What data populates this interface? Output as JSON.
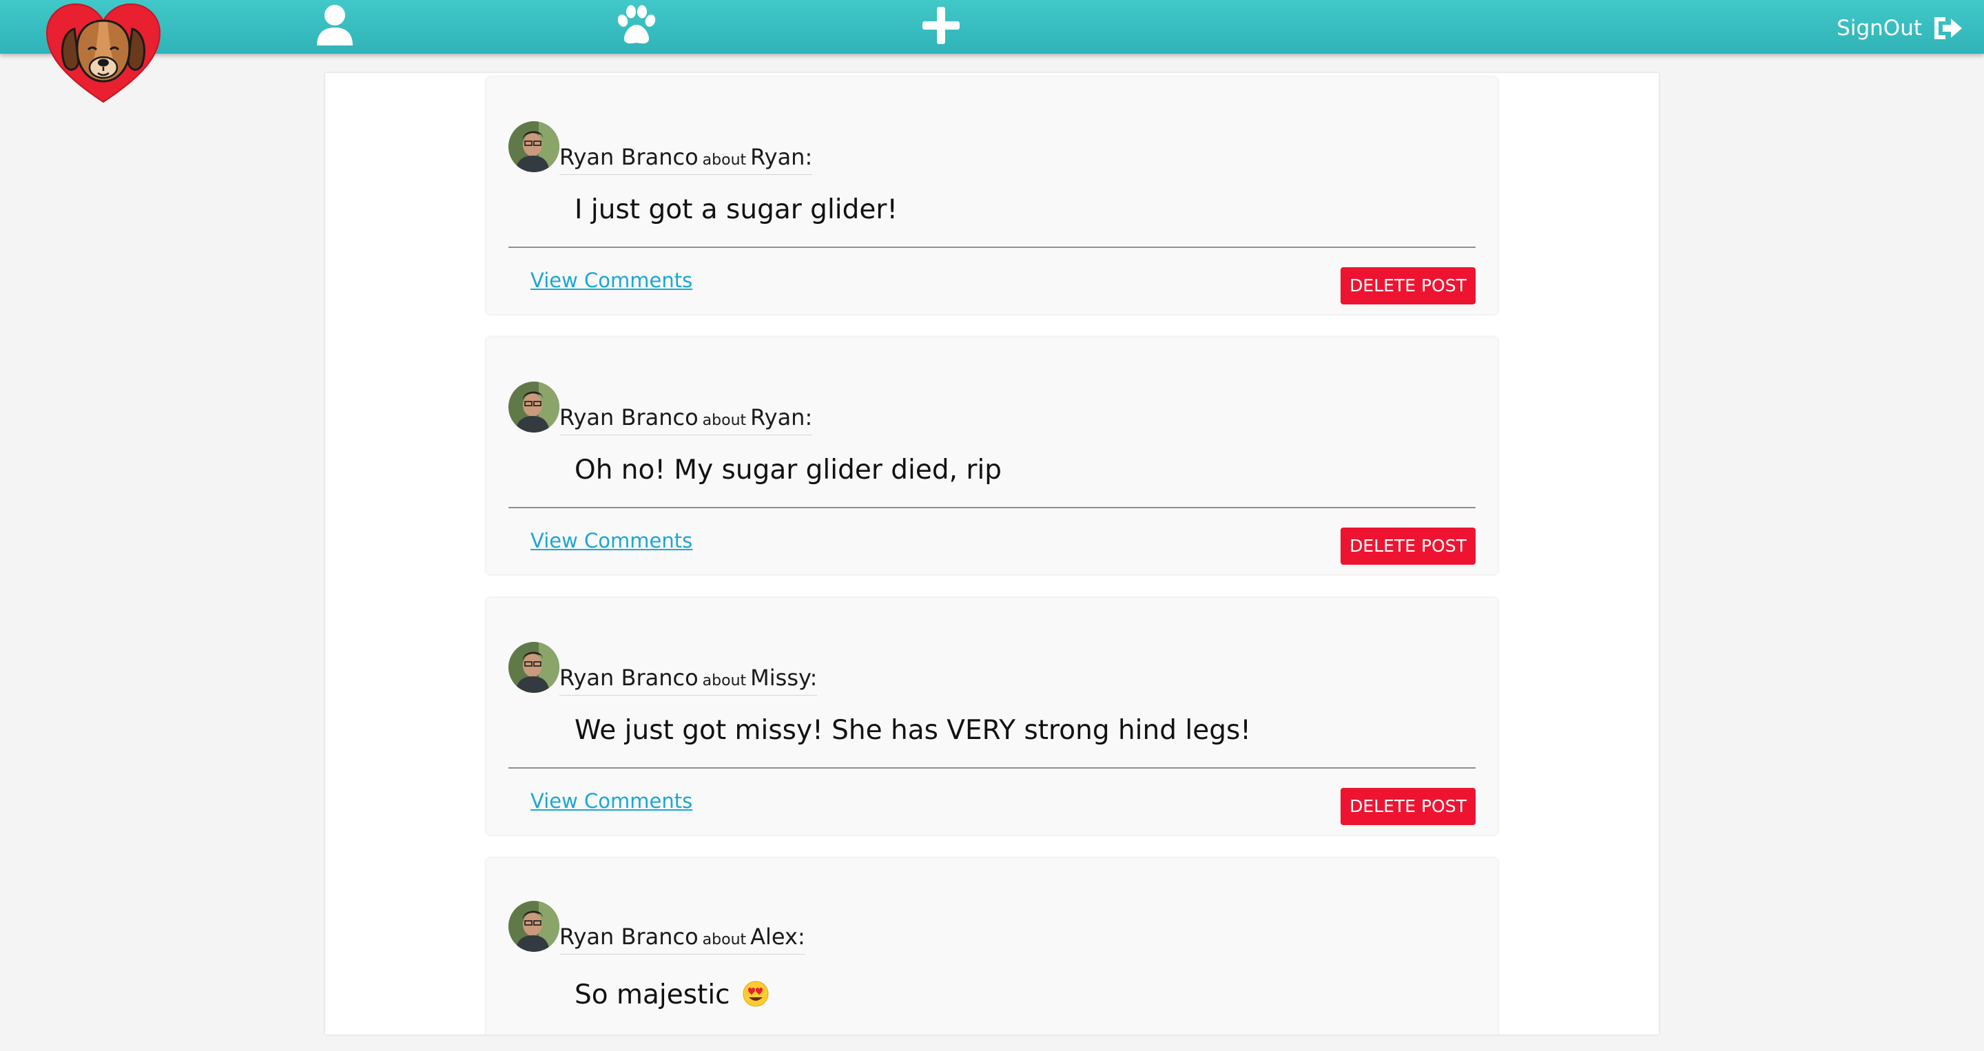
{
  "nav": {
    "icons": [
      "user-icon",
      "paw-icon",
      "plus-icon"
    ],
    "signout_label": "SignOut",
    "colors": {
      "bar": "#3bbfc2",
      "logo_heart": "#e8202f",
      "dog": "#b8733a"
    }
  },
  "posts": [
    {
      "author": "Ryan Branco",
      "about_word": "about",
      "subject": "Ryan:",
      "text": "I just got a sugar glider!",
      "view_comments": "View Comments",
      "delete_label": "DELETE POST"
    },
    {
      "author": "Ryan Branco",
      "about_word": "about",
      "subject": "Ryan:",
      "text": "Oh no! My sugar glider died, rip",
      "view_comments": "View Comments",
      "delete_label": "DELETE POST"
    },
    {
      "author": "Ryan Branco",
      "about_word": "about",
      "subject": "Missy:",
      "text": "We just got missy! She has VERY strong hind legs!",
      "view_comments": "View Comments",
      "delete_label": "DELETE POST"
    },
    {
      "author": "Ryan Branco",
      "about_word": "about",
      "subject": "Alex:",
      "text": "So majestic",
      "emoji": "heart-eyes-emoji"
    }
  ],
  "colors": {
    "delete_button": "#ee1431",
    "link": "#1aa7d6",
    "card_background": "#f9f9f9"
  }
}
